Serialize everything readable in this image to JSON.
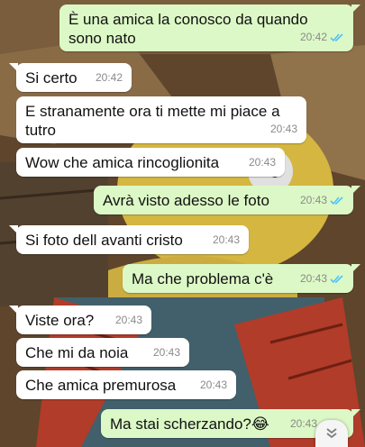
{
  "theme": {
    "incoming_bg": "#ffffff",
    "outgoing_bg": "#dcf8c6",
    "read_tick_color": "#4fc3f7",
    "time_color": "#8a8a8a"
  },
  "messages": [
    {
      "direction": "out",
      "text": "È una amica la conosco da quando sono nato",
      "time": "20:42",
      "status": "read"
    },
    {
      "direction": "in",
      "text": "Si certo",
      "time": "20:42"
    },
    {
      "direction": "in",
      "text": "E stranamente ora ti mette mi piace a tutro",
      "time": "20:43"
    },
    {
      "direction": "in",
      "text": "Wow che amica rincoglionita",
      "time": "20:43"
    },
    {
      "direction": "out",
      "text": "Avrà visto adesso le foto",
      "time": "20:43",
      "status": "read"
    },
    {
      "direction": "in",
      "text": "Si foto dell avanti cristo",
      "time": "20:43"
    },
    {
      "direction": "out",
      "text": "Ma che problema c'è",
      "time": "20:43",
      "status": "read"
    },
    {
      "direction": "in",
      "text": "Viste ora?",
      "time": "20:43"
    },
    {
      "direction": "in",
      "text": "Che mi da noia",
      "time": "20:43"
    },
    {
      "direction": "in",
      "text": "Che amica premurosa",
      "time": "20:43"
    },
    {
      "direction": "out",
      "text": "Ma stai scherzando?😂",
      "time": "20:43",
      "status": "read"
    }
  ],
  "scroll_button": {
    "icon": "double-chevron-down-icon",
    "glyph": "⌄⌄"
  }
}
